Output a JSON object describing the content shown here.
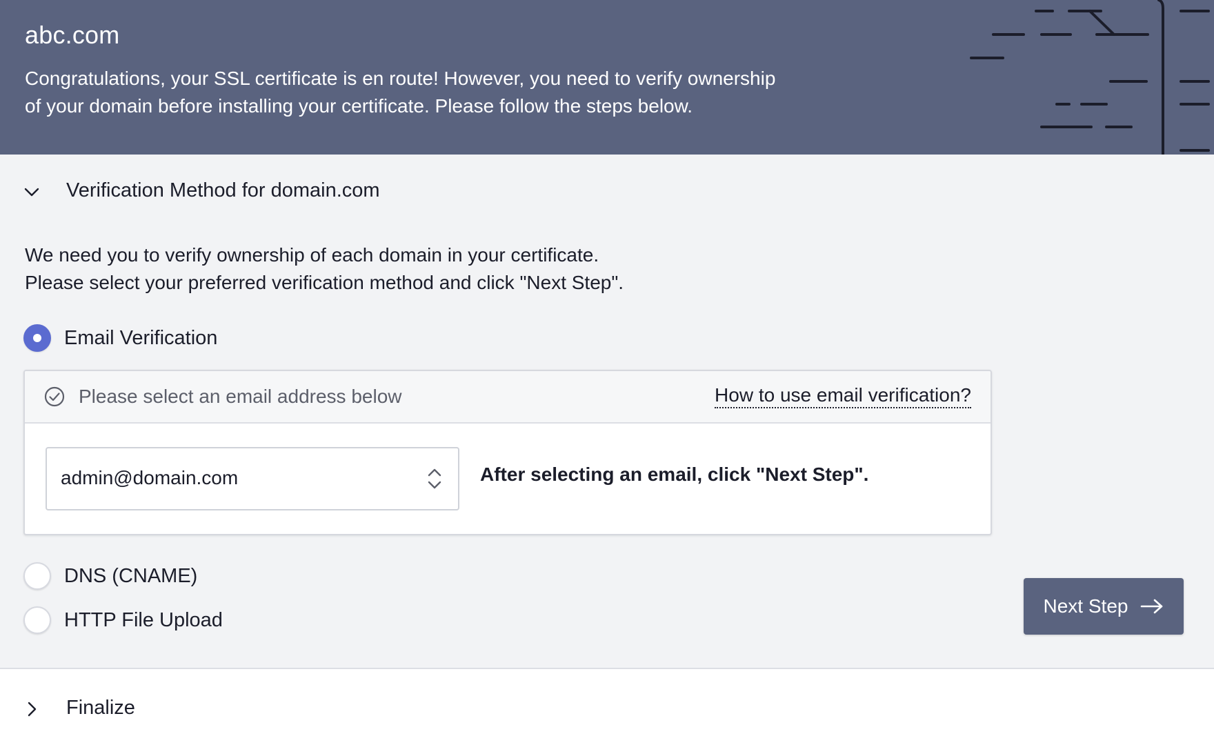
{
  "header": {
    "title": "abc.com",
    "message_line1": "Congratulations, your SSL certificate is en route! However, you need to verify ownership",
    "message_line2": "of your domain before installing your certificate. Please follow the steps below.",
    "background_color": "#5a637f"
  },
  "verification": {
    "section_title": "Verification Method for domain.com",
    "expanded": true,
    "description_line1": "We need you to verify ownership of each domain in your certificate.",
    "description_line2": "Please select your preferred verification method and click \"Next Step\".",
    "methods": [
      {
        "label": "Email Verification",
        "selected": true
      },
      {
        "label": "DNS (CNAME)",
        "selected": false
      },
      {
        "label": "HTTP File Upload",
        "selected": false
      }
    ],
    "email_panel": {
      "prompt": "Please select an email address below",
      "help_link": "How to use email verification?",
      "selected_email": "admin@domain.com",
      "hint": "After selecting an email, click \"Next Step\"."
    },
    "next_button": "Next Step"
  },
  "finalize": {
    "title": "Finalize",
    "expanded": false
  },
  "colors": {
    "accent": "#5b6bd0",
    "button": "#5a637f",
    "section_bg": "#f2f3f5"
  },
  "icons": {
    "section_toggle": "chevron-down-icon",
    "finalize_toggle": "chevron-right-icon",
    "prompt": "check-circle-icon",
    "select": "up-down-arrows-icon",
    "button": "arrow-right-icon"
  }
}
